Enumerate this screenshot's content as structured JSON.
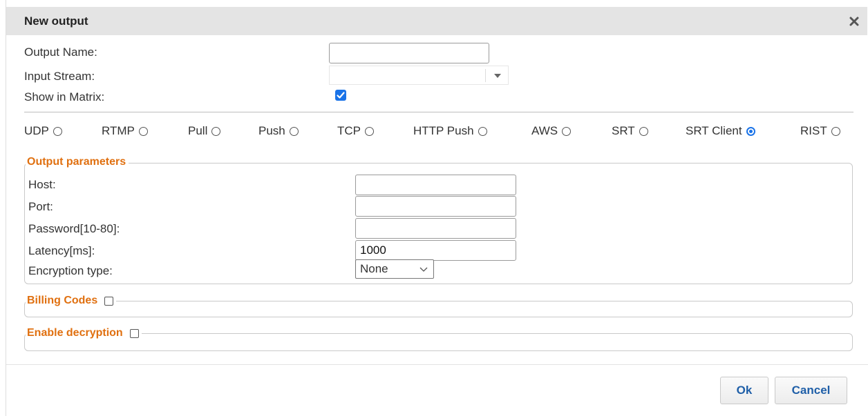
{
  "dialog": {
    "title": "New output",
    "close_icon": "close-icon"
  },
  "form": {
    "output_name_label": "Output Name:",
    "output_name_value": "",
    "input_stream_label": "Input Stream:",
    "input_stream_value": "",
    "show_in_matrix_label": "Show in Matrix:",
    "show_in_matrix_checked": true
  },
  "protocols": [
    {
      "label": "UDP",
      "selected": false
    },
    {
      "label": "RTMP",
      "selected": false
    },
    {
      "label": "Pull",
      "selected": false
    },
    {
      "label": "Push",
      "selected": false
    },
    {
      "label": "TCP",
      "selected": false
    },
    {
      "label": "HTTP Push",
      "selected": false
    },
    {
      "label": "AWS",
      "selected": false
    },
    {
      "label": "SRT",
      "selected": false
    },
    {
      "label": "SRT Client",
      "selected": true
    },
    {
      "label": "RIST",
      "selected": false
    }
  ],
  "output_parameters": {
    "legend": "Output parameters",
    "host_label": "Host:",
    "host_value": "",
    "port_label": "Port:",
    "port_value": "",
    "password_label": "Password[10-80]:",
    "password_value": "",
    "latency_label": "Latency[ms]:",
    "latency_value": "1000",
    "encryption_label": "Encryption type:",
    "encryption_value": "None"
  },
  "billing": {
    "legend": "Billing Codes",
    "checked": false
  },
  "decryption": {
    "legend": "Enable decryption",
    "checked": false
  },
  "buttons": {
    "ok": "Ok",
    "cancel": "Cancel"
  },
  "colors": {
    "accent": "#1a73e8",
    "legend": "#e07010",
    "button_text": "#1f5fa8",
    "titlebar": "#e4e4e4"
  }
}
